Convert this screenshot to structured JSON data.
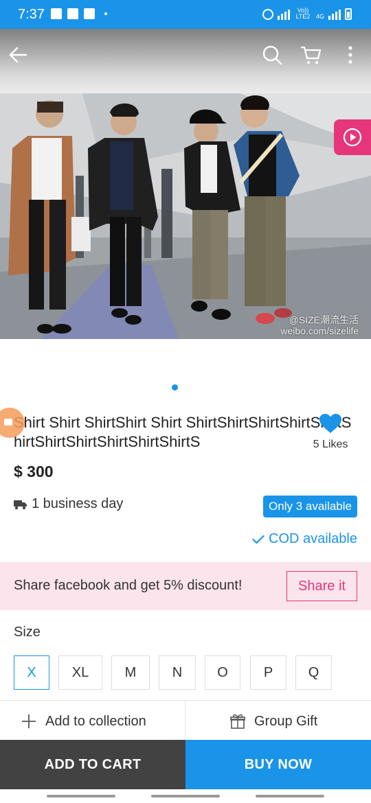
{
  "status_bar": {
    "time": "7:37",
    "volte_label": "Vo)) LTE2",
    "network_label": "4G"
  },
  "app_bar": {
    "back_icon": "arrow-left-icon",
    "search_icon": "search-icon",
    "cart_icon": "cart-icon",
    "more_icon": "more-vertical-icon"
  },
  "hero": {
    "watermark_line1": "@SIZE潮流生活",
    "watermark_line2": "weibo.com/sizelife",
    "play_icon": "play-icon"
  },
  "product": {
    "title": "Shirt Shirt ShirtShirt Shirt ShirtShirtShirtShirtShirtShirtShirtShirtShirtShirtShirtS",
    "likes_label": "5 Likes",
    "price": "$ 300",
    "delivery_label": "1 business day",
    "availability_badge": "Only 3 available",
    "cod_label": "COD available"
  },
  "share": {
    "text": "Share facebook and get 5% discount!",
    "button_label": "Share it"
  },
  "size": {
    "label": "Size",
    "options": [
      "X",
      "XL",
      "M",
      "N",
      "O",
      "P",
      "Q"
    ],
    "selected": "X"
  },
  "actions": {
    "collection_label": "Add to collection",
    "gift_label": "Group Gift"
  },
  "bottom": {
    "add_to_cart": "ADD TO CART",
    "buy_now": "BUY NOW"
  },
  "colors": {
    "accent": "#1a94e8",
    "pink": "#e6357a",
    "dark": "#424242",
    "banner": "#fbe4ec"
  }
}
